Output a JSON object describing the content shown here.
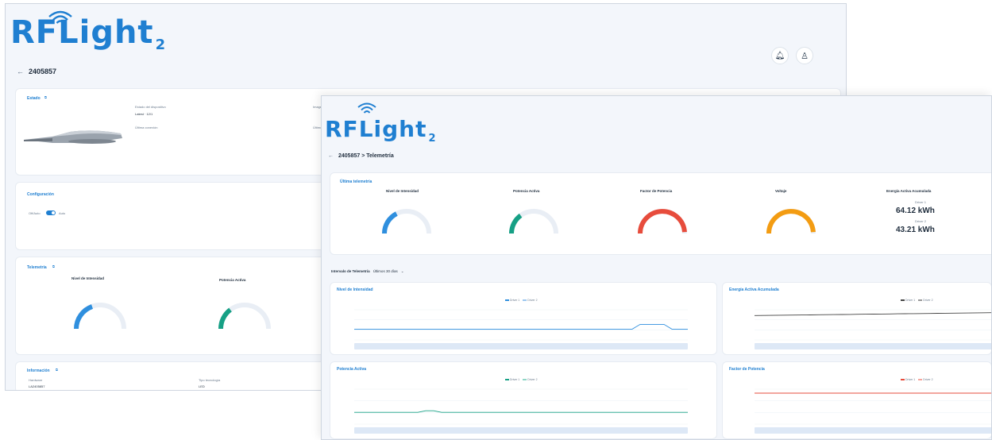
{
  "brand": {
    "name": "RFLight",
    "sub": "2",
    "color": "#1f7fd1"
  },
  "back": {
    "breadcrumb": "2405857",
    "sections": {
      "estado": "Estado",
      "configuracion": "Configuración",
      "telemetria": "Telemetría",
      "informacion": "Información"
    },
    "estado": {
      "f1_label": "Estado del dispositivo",
      "f1_value": "Latest · 12/1",
      "f2_label": "Última conexión",
      "f3_label": "Imagen",
      "f4_label": "Último"
    },
    "config": {
      "left": "Off/Auto",
      "right": "Auto"
    },
    "telemetry": {
      "g1_title": "Nivel de Intensidad",
      "g2_title": "Potencia Activa"
    },
    "info": {
      "c1_label": "Hardware",
      "c1_value": "LA2405857",
      "c2_label": "Tipo tecnología",
      "c2_value": "LED"
    }
  },
  "front": {
    "breadcrumb": "2405857 > Telemetría",
    "last_section": "Última telemetría",
    "gauges": [
      {
        "title": "Nivel de Intensidad",
        "color": "#2f8fde",
        "fill": 0.35
      },
      {
        "title": "Potencia Activa",
        "color": "#16a085",
        "fill": 0.3
      },
      {
        "title": "Factor de Potencia",
        "color": "#e74c3c",
        "fill": 0.98
      },
      {
        "title": "Voltaje",
        "color": "#f39c12",
        "fill": 0.98
      }
    ],
    "energy": {
      "title": "Energía Activa Acumulada",
      "driver1_label": "Driver 1",
      "driver1_value": "64.12 kWh",
      "driver2_label": "Driver 2",
      "driver2_value": "43.21 kWh"
    },
    "interval": {
      "label": "Intervalo de Telemetría",
      "value": "Últimos 30 días"
    },
    "charts": [
      {
        "title": "Nivel de Intensidad",
        "color": "#2f8fde",
        "legend": [
          "Driver 1",
          "Driver 2"
        ]
      },
      {
        "title": "Energía Activa Acumulada",
        "color": "#444444",
        "legend": [
          "Driver 1",
          "Driver 2"
        ]
      },
      {
        "title": "Potencia Activa",
        "color": "#16a085",
        "legend": [
          "Driver 1",
          "Driver 2"
        ]
      },
      {
        "title": "Factor de Potencia",
        "color": "#e74c3c",
        "legend": [
          "Driver 1",
          "Driver 2"
        ]
      }
    ]
  }
}
